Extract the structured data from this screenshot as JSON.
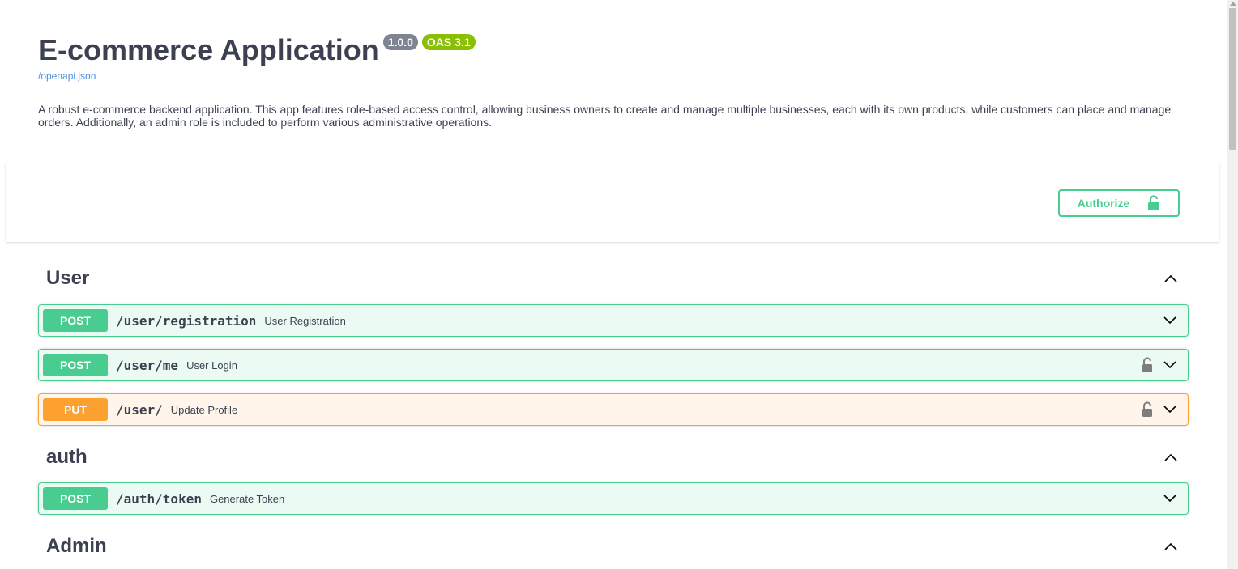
{
  "info": {
    "title": "E-commerce Application",
    "version_badge": "1.0.0",
    "oas_badge": "OAS 3.1",
    "spec_link": "/openapi.json",
    "description": "A robust e-commerce backend application. This app features role-based access control, allowing business owners to create and manage multiple businesses, each with its own products, while customers can place and manage orders. Additionally, an admin role is included to perform various administrative operations."
  },
  "authorize": {
    "label": "Authorize",
    "icon": "unlocked-padlock-icon"
  },
  "tags": [
    {
      "name": "User",
      "operations": [
        {
          "method": "POST",
          "path": "/user/registration",
          "summary": "User Registration",
          "locked": false
        },
        {
          "method": "POST",
          "path": "/user/me",
          "summary": "User Login",
          "locked": true
        },
        {
          "method": "PUT",
          "path": "/user/",
          "summary": "Update Profile",
          "locked": true
        }
      ]
    },
    {
      "name": "auth",
      "operations": [
        {
          "method": "POST",
          "path": "/auth/token",
          "summary": "Generate Token",
          "locked": false
        }
      ]
    },
    {
      "name": "Admin",
      "operations": []
    }
  ],
  "colors": {
    "post": "#49cc90",
    "put": "#fca130",
    "text": "#3b4151",
    "link": "#4990e2",
    "version_badge": "#7d8492",
    "oas_badge": "#89bf04"
  }
}
